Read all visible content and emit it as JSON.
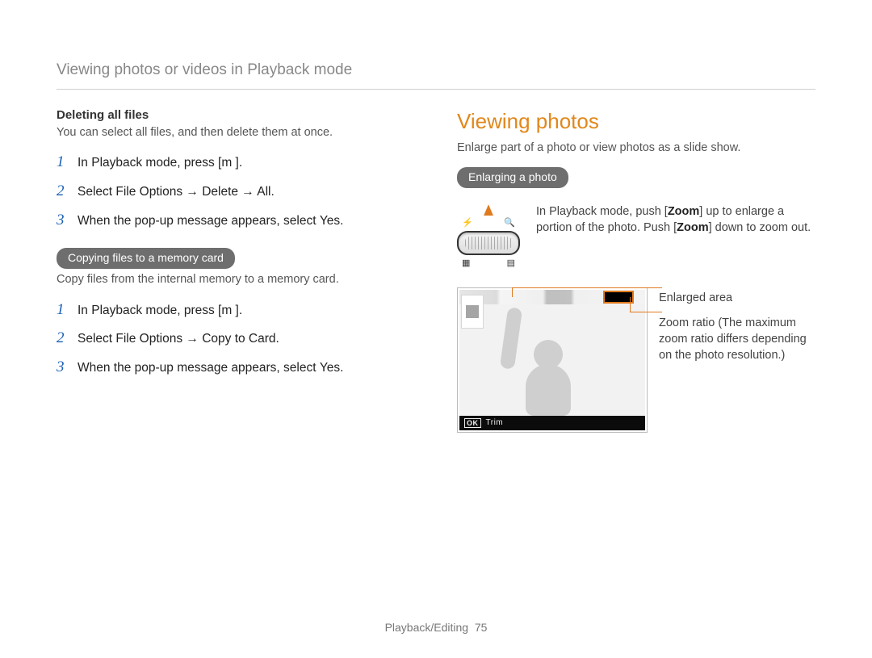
{
  "header": "Viewing photos or videos in Playback mode",
  "left": {
    "del": {
      "title": "Deleting all ﬁles",
      "desc": "You can select all files, and then delete them at once.",
      "steps": [
        {
          "n": "1",
          "t": "In Playback mode, press [m          ]."
        },
        {
          "n": "2",
          "t": "Select File Options → Delete → All."
        },
        {
          "n": "3",
          "t": "When the pop-up message appears, select Yes."
        }
      ]
    },
    "copy": {
      "pill": "Copying ﬁles to a memory card",
      "desc": "Copy files from the internal memory to a memory card.",
      "steps": [
        {
          "n": "1",
          "t": "In Playback mode, press [m          ]."
        },
        {
          "n": "2",
          "t": "Select File Options → Copy to Card."
        },
        {
          "n": "3",
          "t": "When the pop-up message appears, select Yes."
        }
      ]
    }
  },
  "right": {
    "title": "Viewing photos",
    "desc": "Enlarge part of a photo or view photos as a slide show.",
    "pill": "Enlarging a photo",
    "zoom_text_pre": "In Playback mode, push [",
    "zoom_text_b1": "Zoom",
    "zoom_text_mid": "] up to enlarge a portion of the photo. Push [",
    "zoom_text_b2": "Zoom",
    "zoom_text_post": "] down to zoom out.",
    "legend1": "Enlarged area",
    "legend2": "Zoom ratio (The maximum zoom ratio differs depending on the photo resolution.)",
    "trim_ok": "OK",
    "trim_label": "Trim"
  },
  "footer": {
    "section": "Playback/Editing",
    "page": "75"
  }
}
